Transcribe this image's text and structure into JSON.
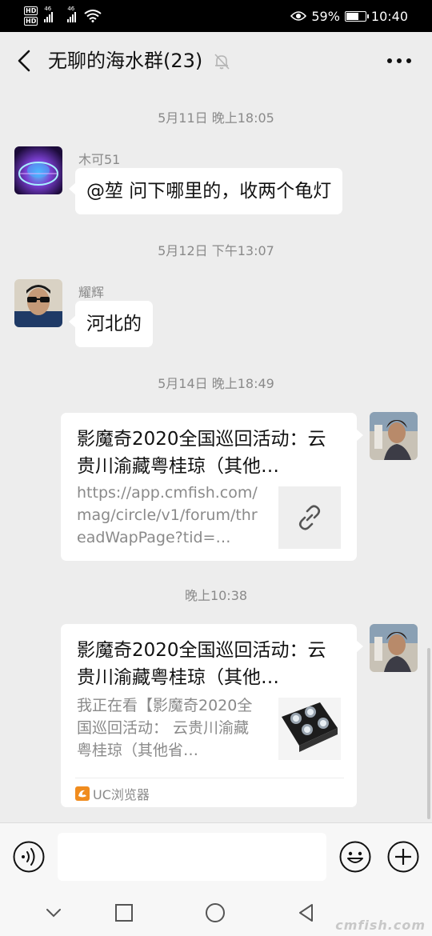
{
  "status_bar": {
    "hd1": "HD",
    "hd2": "HD",
    "net1": "46",
    "net2": "46",
    "battery_percent": "59%",
    "battery_level": 0.59,
    "time": "10:40"
  },
  "header": {
    "title": "无聊的海水群(23)"
  },
  "messages": [
    {
      "timestamp": "5月11日 晚上18:05",
      "sender": "木可51",
      "text": "@堃  问下哪里的，收两个龟灯"
    },
    {
      "timestamp": "5月12日 下午13:07",
      "sender": "耀辉",
      "text": "河北的"
    },
    {
      "timestamp": "5月14日 晚上18:49",
      "card_title": "影魔奇2020全国巡回活动：云贵川渝藏粤桂琼（其他…",
      "card_desc": "https://app.cmfish.com/mag/circle/v1/forum/threadWapPage?tid=…"
    },
    {
      "timestamp": "晚上10:38",
      "card_title": "影魔奇2020全国巡回活动：云贵川渝藏粤桂琼（其他…",
      "card_desc": "我正在看【影魔奇2020全国巡回活动： 云贵川渝藏粤桂琼（其他省…",
      "card_source": "UC浏览器"
    }
  ],
  "watermark": "cmfish.com",
  "colors": {
    "bg": "#ededed",
    "bubble": "#ffffff",
    "timestamp": "#8a8a8a",
    "uc_orange": "#f08c1e"
  }
}
